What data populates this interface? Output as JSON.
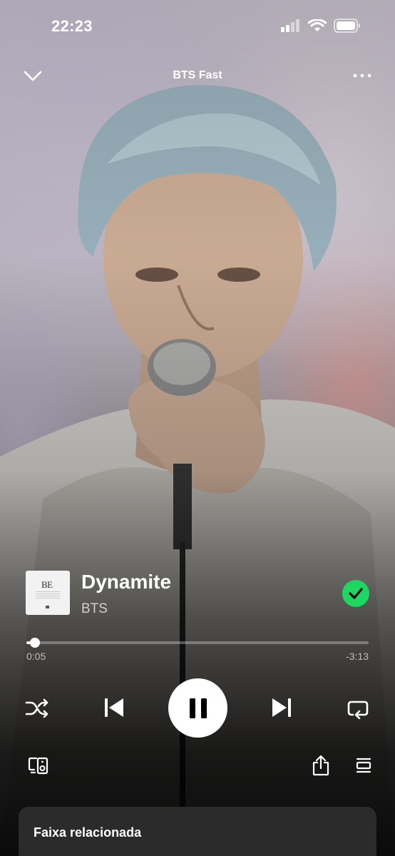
{
  "status_bar": {
    "time": "22:23"
  },
  "header": {
    "title": "BTS Fast"
  },
  "track": {
    "album_art_text": "BE",
    "title": "Dynamite",
    "artist": "BTS",
    "liked": true
  },
  "progress": {
    "elapsed": "0:05",
    "remaining": "-3:13",
    "fraction": 0.026
  },
  "related": {
    "title": "Faixa relacionada"
  },
  "colors": {
    "accent": "#1ed760",
    "background": "#121212",
    "card": "#2b2b2b"
  },
  "icons": {
    "collapse": "chevron-down-icon",
    "more": "more-horizontal-icon",
    "liked": "check-circle-icon",
    "shuffle": "shuffle-icon",
    "previous": "skip-previous-icon",
    "pause": "pause-icon",
    "next": "skip-next-icon",
    "repeat": "repeat-icon",
    "devices": "connect-device-icon",
    "share": "share-icon",
    "queue": "queue-icon"
  }
}
